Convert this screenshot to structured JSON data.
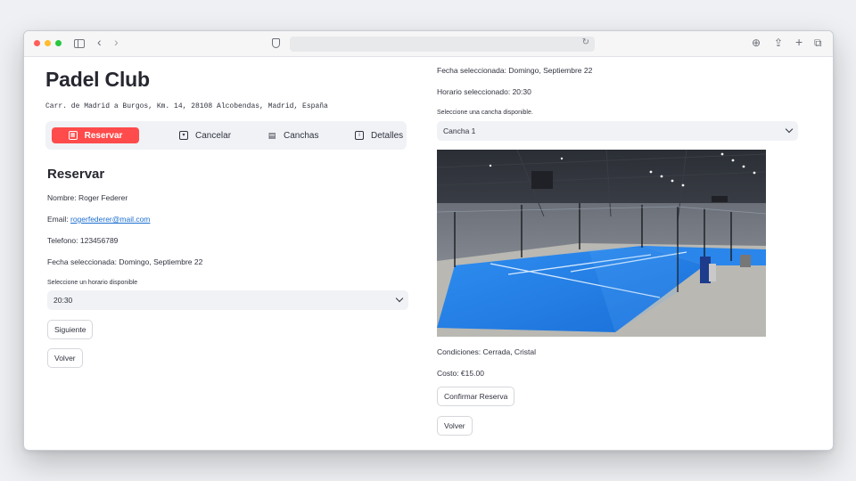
{
  "app": {
    "title": "Padel Club",
    "address": "Carr. de Madrid a Burgos, Km. 14, 28108 Alcobendas, Madrid, España"
  },
  "nav": {
    "items": [
      {
        "label": "Reservar",
        "icon": "calendar-icon",
        "active": true
      },
      {
        "label": "Cancelar",
        "icon": "calendar-x-icon",
        "active": false
      },
      {
        "label": "Canchas",
        "icon": "building-icon",
        "active": false
      },
      {
        "label": "Detalles",
        "icon": "info-icon",
        "active": false
      }
    ],
    "accent": "#ff4b4b"
  },
  "reservar": {
    "heading": "Reservar",
    "nombre": "Nombre: Roger Federer",
    "email_label": "Email: ",
    "email": "rogerfederer@mail.com",
    "telefono": "Telefono: 123456789",
    "fecha": "Fecha seleccionada: Domingo, Septiembre 22",
    "horario_label": "Seleccione un horario disponible",
    "horario_value": "20:30",
    "siguiente": "Siguiente",
    "volver": "Volver"
  },
  "right": {
    "fecha": "Fecha seleccionada: Domingo, Septiembre 22",
    "horario": "Horario seleccionado: 20:30",
    "cancha_label": "Seleccione una cancha disponible.",
    "cancha_value": "Cancha 1",
    "condiciones": "Condiciones: Cerrada, Cristal",
    "costo": "Costo: €15.00",
    "confirmar": "Confirmar Reserva",
    "volver": "Volver"
  }
}
